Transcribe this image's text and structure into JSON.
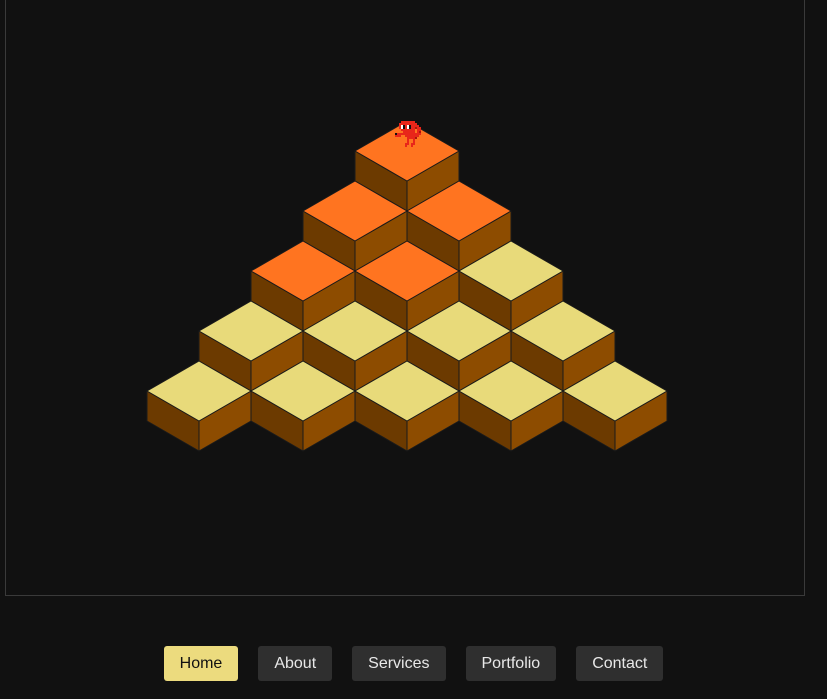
{
  "game": {
    "rows": 5,
    "colors": {
      "top_default": "#e8da7a",
      "top_activated": "#ff7420",
      "left_face": "#6c3a00",
      "right_face": "#8d4c00",
      "edge": "#1a1a1a",
      "background": "#111111"
    },
    "cubes": [
      {
        "row": 0,
        "col": 0,
        "activated": true
      },
      {
        "row": 1,
        "col": 0,
        "activated": true
      },
      {
        "row": 1,
        "col": 1,
        "activated": true
      },
      {
        "row": 2,
        "col": 0,
        "activated": true
      },
      {
        "row": 2,
        "col": 1,
        "activated": true
      },
      {
        "row": 2,
        "col": 2,
        "activated": false
      },
      {
        "row": 3,
        "col": 0,
        "activated": false
      },
      {
        "row": 3,
        "col": 1,
        "activated": false
      },
      {
        "row": 3,
        "col": 2,
        "activated": false
      },
      {
        "row": 3,
        "col": 3,
        "activated": false
      },
      {
        "row": 4,
        "col": 0,
        "activated": false
      },
      {
        "row": 4,
        "col": 1,
        "activated": false
      },
      {
        "row": 4,
        "col": 2,
        "activated": false
      },
      {
        "row": 4,
        "col": 3,
        "activated": false
      },
      {
        "row": 4,
        "col": 4,
        "activated": false
      }
    ],
    "player": {
      "row": 0,
      "col": 0,
      "sprite": "qbert-character",
      "color": "#e8261a"
    }
  },
  "nav": {
    "items": [
      {
        "label": "Home",
        "active": true
      },
      {
        "label": "About",
        "active": false
      },
      {
        "label": "Services",
        "active": false
      },
      {
        "label": "Portfolio",
        "active": false
      },
      {
        "label": "Contact",
        "active": false
      }
    ]
  }
}
